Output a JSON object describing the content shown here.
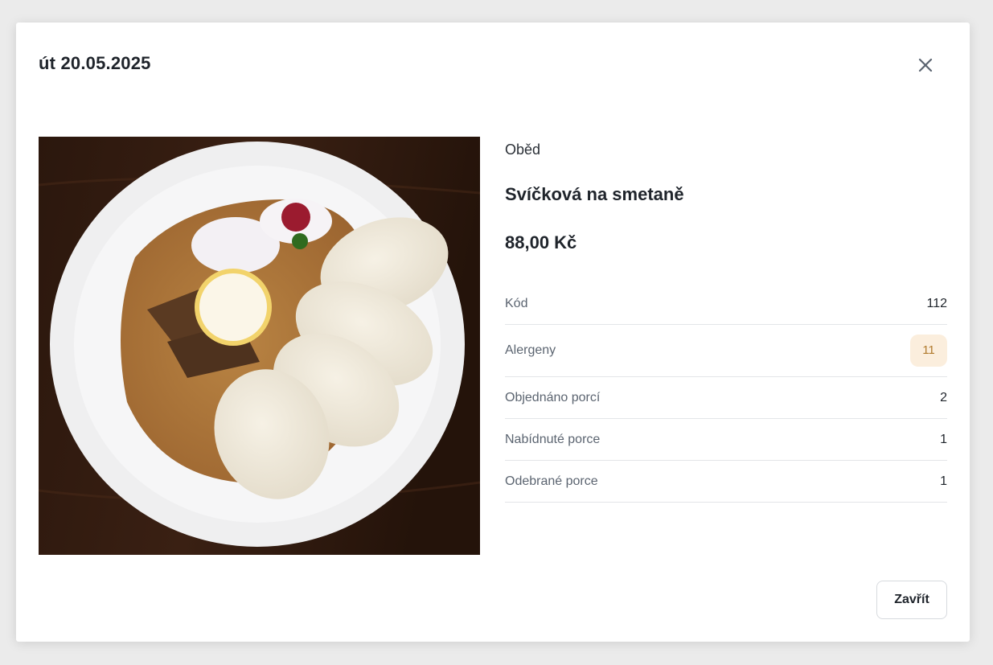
{
  "modal": {
    "title": "út 20.05.2025",
    "close_icon": "close-icon",
    "footer_button": "Zavřít"
  },
  "meal": {
    "type": "Oběd",
    "name": "Svíčková na smetaně",
    "price": "88,00 Kč",
    "image_icon": "meal-photo"
  },
  "details": {
    "rows": [
      {
        "label": "Kód",
        "value": "112"
      },
      {
        "label": "Alergeny",
        "value": "11"
      },
      {
        "label": "Objednáno porcí",
        "value": "2"
      },
      {
        "label": "Nabídnuté porce",
        "value": "1"
      },
      {
        "label": "Odebrané porce",
        "value": "1"
      }
    ]
  },
  "colors": {
    "backdrop": "#ebebeb",
    "badge_bg": "#fbeedd",
    "badge_text": "#b07a2c",
    "divider": "#e3e5e8"
  }
}
